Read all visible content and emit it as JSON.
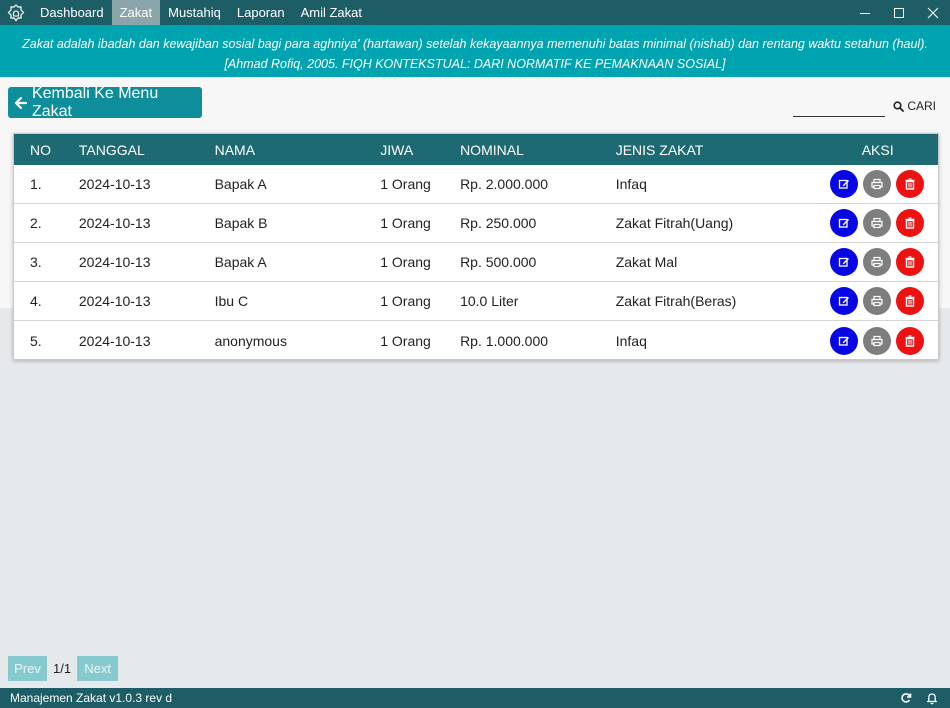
{
  "menu": {
    "items": [
      {
        "label": "Dashboard"
      },
      {
        "label": "Zakat"
      },
      {
        "label": "Mustahiq"
      },
      {
        "label": "Laporan"
      },
      {
        "label": "Amil Zakat"
      }
    ],
    "active_index": 1
  },
  "banner": {
    "quote": "Zakat adalah ibadah dan kewajiban sosial bagi para aghniya' (hartawan) setelah kekayaannya memenuhi batas minimal (nishab) dan rentang waktu setahun (haul).[Ahmad Rofiq, 2005. FIQH KONTEKSTUAL: DARI NORMATIF KE PEMAKNAAN SOSIAL]"
  },
  "back_button": {
    "label": "Kembali Ke Menu Zakat",
    "icon": "arrow-left-icon"
  },
  "search": {
    "value": "",
    "button_label": "CARI",
    "icon": "search-icon"
  },
  "table": {
    "headers": {
      "no": "NO",
      "tanggal": "TANGGAL",
      "nama": "NAMA",
      "jiwa": "JIWA",
      "nominal": "NOMINAL",
      "jenis": "JENIS ZAKAT",
      "aksi": "AKSI"
    },
    "rows": [
      {
        "no": "1.",
        "tanggal": "2024-10-13",
        "nama": "Bapak A",
        "jiwa": "1 Orang",
        "nominal": "Rp. 2.000.000",
        "jenis": "Infaq"
      },
      {
        "no": "2.",
        "tanggal": "2024-10-13",
        "nama": "Bapak B",
        "jiwa": "1 Orang",
        "nominal": "Rp. 250.000",
        "jenis": "Zakat Fitrah(Uang)"
      },
      {
        "no": "3.",
        "tanggal": "2024-10-13",
        "nama": "Bapak A",
        "jiwa": "1 Orang",
        "nominal": "Rp. 500.000",
        "jenis": "Zakat Mal"
      },
      {
        "no": "4.",
        "tanggal": "2024-10-13",
        "nama": "Ibu C",
        "jiwa": "1 Orang",
        "nominal": "10.0 Liter",
        "jenis": "Zakat Fitrah(Beras)"
      },
      {
        "no": "5.",
        "tanggal": "2024-10-13",
        "nama": "anonymous",
        "jiwa": "1 Orang",
        "nominal": "Rp. 1.000.000",
        "jenis": "Infaq"
      }
    ],
    "action_icons": [
      "edit-icon",
      "print-icon",
      "delete-icon"
    ]
  },
  "pagination": {
    "prev_label": "Prev",
    "page_info": "1/1",
    "next_label": "Next"
  },
  "statusbar": {
    "version": "Manajemen Zakat v1.0.3 rev d",
    "icons": [
      "refresh-icon",
      "bell-icon"
    ]
  },
  "colors": {
    "titlebar": "#1d5e66",
    "banner": "#00a3b0",
    "table_header": "#1d6a73",
    "edit": "#0707e6",
    "print": "#7e7e7e",
    "delete": "#ee1111"
  }
}
